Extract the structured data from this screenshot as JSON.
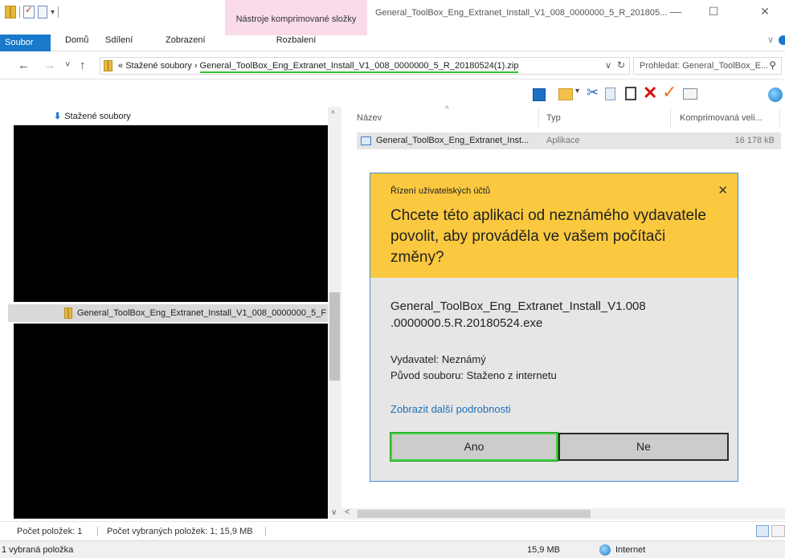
{
  "window": {
    "title": "General_ToolBox_Eng_Extranet_Install_V1_008_0000000_5_R_201805...",
    "context_group": "Nástroje komprimované složky",
    "minimize_glyph": "—",
    "maximize_glyph": "☐",
    "close_glyph": "✕"
  },
  "ribbon": {
    "tabs": [
      "Soubor",
      "Domů",
      "Sdílení",
      "Zobrazení"
    ],
    "context_tab": "Rozbalení",
    "collapse_glyph": "∨"
  },
  "address": {
    "back": "←",
    "forward": "→",
    "recent": "˅",
    "up": "↑",
    "overflow": "«",
    "parent": "Stažené soubory",
    "separator": "›",
    "current": "General_ToolBox_Eng_Extranet_Install_V1_008_0000000_5_R_20180524(1).zip",
    "dropdown": "∨",
    "refresh": "↻",
    "search_placeholder": "Prohledat: General_ToolBox_E...",
    "search_icon": "⚲"
  },
  "toolbar": {
    "cut_glyph": "✂",
    "delete_glyph": "✕",
    "ok_glyph": "✓",
    "caret": "▾"
  },
  "nav": {
    "downloads": "Stažené soubory",
    "selected_item": "General_ToolBox_Eng_Extranet_Install_V1_008_0000000_5_F",
    "scroll_up": "^",
    "scroll_down": "∨"
  },
  "filelist": {
    "columns": [
      "Název",
      "Typ",
      "Komprimovaná veli..."
    ],
    "sort_glyph": "^",
    "rows": [
      {
        "name": "General_ToolBox_Eng_Extranet_Inst...",
        "type": "Aplikace",
        "size": "16 178 kB"
      }
    ],
    "scroll_left": "<"
  },
  "uac": {
    "caption": "Řízení uživatelských účtů",
    "close": "✕",
    "question": "Chcete této aplikaci od neznámého vydavatele povolit, aby prováděla ve vašem počítači změny?",
    "app_name": "General_ToolBox_Eng_Extranet_Install_V1.008 .0000000.5.R.20180524.exe",
    "publisher": "Vydavatel: Neznámý",
    "origin": "Původ souboru: Staženo z internetu",
    "more_details": "Zobrazit další podrobnosti",
    "yes": "Ano",
    "no": "Ne"
  },
  "statusbar": {
    "item_count": "Počet položek: 1",
    "selected_count": "Počet vybraných položek: 1; 15,9 MB",
    "selected_label": "1 vybraná položka",
    "size": "15,9 MB",
    "zone": "Internet"
  },
  "colors": {
    "accent": "#1979ca",
    "uac_header": "#fbc93f",
    "delete_red": "#d40f0f",
    "highlight_green": "#3fd33f"
  }
}
